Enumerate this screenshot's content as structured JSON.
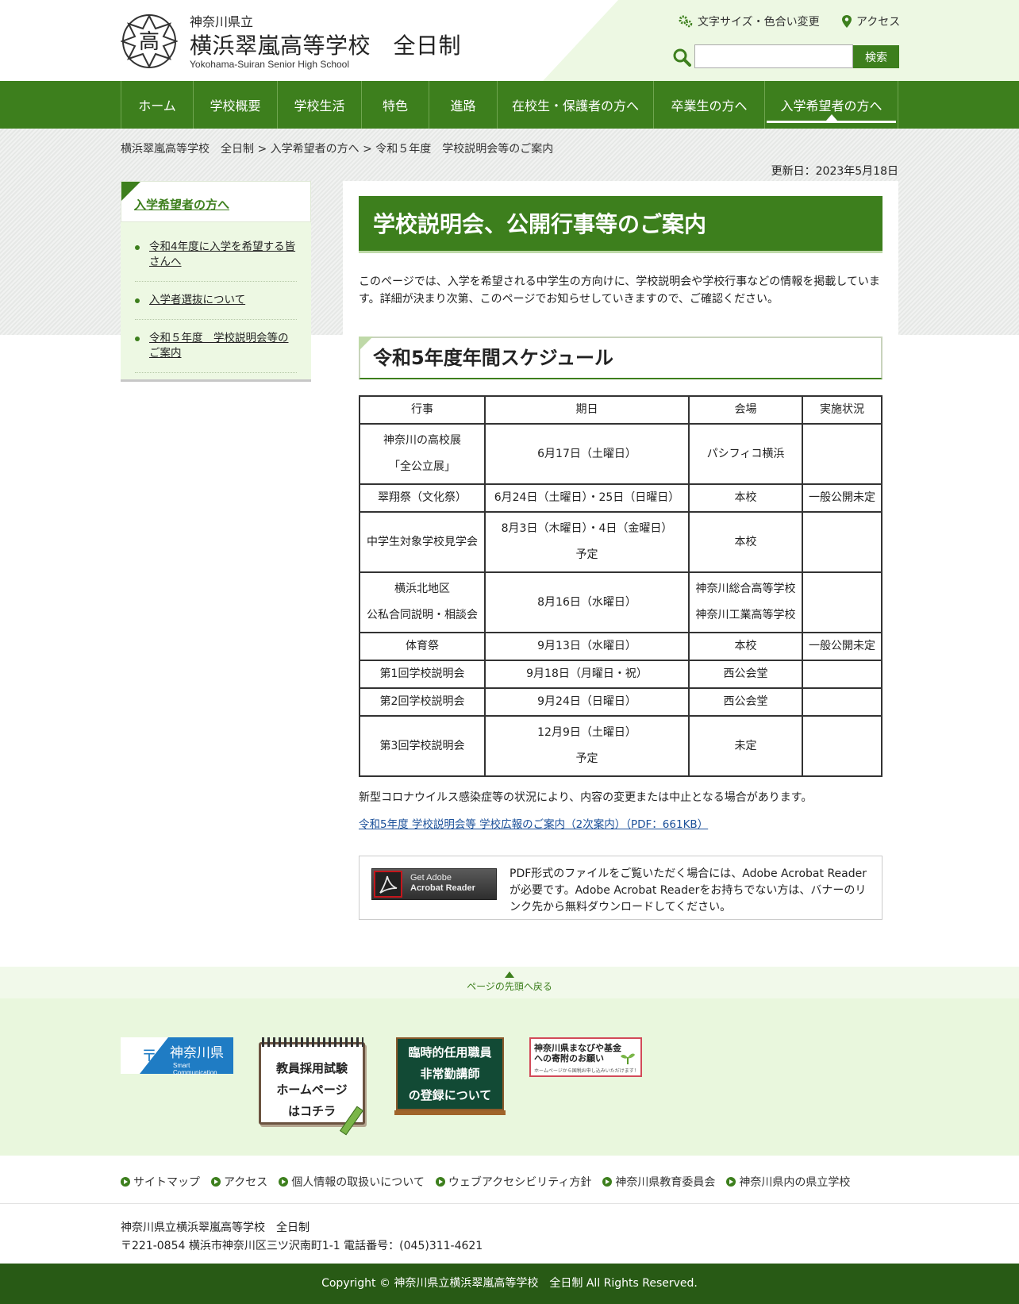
{
  "header": {
    "pref": "神奈川県立",
    "school_name": "横浜翠嵐高等学校　全日制",
    "school_en": "Yokohama-Suiran Senior High School",
    "font_color_link": "文字サイズ・色合い変更",
    "access_link": "アクセス",
    "search_placeholder": "",
    "search_button": "検索"
  },
  "nav": [
    {
      "label": "ホーム"
    },
    {
      "label": "学校概要"
    },
    {
      "label": "学校生活"
    },
    {
      "label": "特色"
    },
    {
      "label": "進路"
    },
    {
      "label": "在校生・保護者の方へ"
    },
    {
      "label": "卒業生の方へ"
    },
    {
      "label": "入学希望者の方へ",
      "active": true
    }
  ],
  "breadcrumb": "横浜翠嵐高等学校　全日制 > 入学希望者の方へ > 令和５年度　学校説明会等のご案内",
  "updated": "更新日：2023年5月18日",
  "sidebar": {
    "heading": "入学希望者の方へ",
    "items": [
      {
        "label": "令和4年度に入学を希望する皆さんへ"
      },
      {
        "label": "入学者選抜について"
      },
      {
        "label": "令和５年度　学校説明会等のご案内"
      }
    ]
  },
  "main": {
    "title": "学校説明会、公開行事等のご案内",
    "intro": "このページでは、入学を希望される中学生の方向けに、学校説明会や学校行事などの情報を掲載しています。詳細が決まり次第、このページでお知らせしていきますので、ご確認ください。",
    "section_heading": "令和5年度年間スケジュール",
    "table": {
      "headers": [
        "行事",
        "期日",
        "会場",
        "実施状況"
      ],
      "rows": [
        {
          "event": [
            "神奈川の高校展",
            "「全公立展」"
          ],
          "date": [
            "6月17日（土曜日）"
          ],
          "venue": [
            "パシフィコ横浜"
          ],
          "status": ""
        },
        {
          "event": [
            "翠翔祭（文化祭）"
          ],
          "date": [
            "6月24日（土曜日）・25日（日曜日）"
          ],
          "venue": [
            "本校"
          ],
          "status": "一般公開未定"
        },
        {
          "event": [
            "中学生対象学校見学会"
          ],
          "date": [
            "8月3日（木曜日）・4日（金曜日）",
            "予定"
          ],
          "venue": [
            "本校"
          ],
          "status": ""
        },
        {
          "event": [
            "横浜北地区",
            "公私合同説明・相談会"
          ],
          "date": [
            "8月16日（水曜日）"
          ],
          "venue": [
            "神奈川総合高等学校",
            "神奈川工業高等学校"
          ],
          "status": ""
        },
        {
          "event": [
            "体育祭"
          ],
          "date": [
            "9月13日（水曜日）"
          ],
          "venue": [
            "本校"
          ],
          "status": "一般公開未定"
        },
        {
          "event": [
            "第1回学校説明会"
          ],
          "date": [
            "9月18日（月曜日・祝）"
          ],
          "venue": [
            "西公会堂"
          ],
          "status": ""
        },
        {
          "event": [
            "第2回学校説明会"
          ],
          "date": [
            "9月24日（日曜日）"
          ],
          "venue": [
            "西公会堂"
          ],
          "status": ""
        },
        {
          "event": [
            "第3回学校説明会"
          ],
          "date": [
            "12月9日（土曜日）",
            "予定"
          ],
          "venue": [
            "未定"
          ],
          "status": ""
        }
      ]
    },
    "note": "新型コロナウイルス感染症等の状況により、内容の変更または中止となる場合があります。",
    "pdf_link": "令和5年度 学校説明会等 学校広報のご案内（2次案内）（PDF：661KB）",
    "acrobat": {
      "banner_line1": "Get Adobe",
      "banner_line2": "Acrobat Reader",
      "desc": "PDF形式のファイルをご覧いただく場合には、Adobe Acrobat Readerが必要です。Adobe Acrobat Readerをお持ちでない方は、バナーのリンク先から無料ダウンロードしてください。"
    }
  },
  "footer": {
    "pagetop": "ページの先頭へ戻る",
    "banners": {
      "kanagawa_title": "神奈川県",
      "kanagawa_sub": "Smart Communication",
      "teacher": [
        "教員採用試験",
        "ホームページ",
        "はコチラ"
      ],
      "temp": [
        "臨時的任用職員",
        "非常勤講師",
        "の登録について"
      ],
      "fund_title": "神奈川県まなびや基金への寄附のお願い",
      "fund_sub": "ホームページから国税お申し込みいただけます！"
    },
    "links": [
      {
        "label": "サイトマップ"
      },
      {
        "label": "アクセス"
      },
      {
        "label": "個人情報の取扱いについて"
      },
      {
        "label": "ウェブアクセシビリティ方針"
      },
      {
        "label": "神奈川県教育委員会"
      },
      {
        "label": "神奈川県内の県立学校"
      }
    ],
    "address_name": "神奈川県立横浜翠嵐高等学校　全日制",
    "address_line": "〒221-0854 横浜市神奈川区三ツ沢南町1-1 電話番号：(045)311-4621",
    "copyright": "Copyright © 神奈川県立横浜翠嵐高等学校　全日制 All Rights Reserved."
  },
  "colors": {
    "brand_green": "#3d7f1d",
    "light_green": "#edf8e3",
    "footer_dark": "#285a15",
    "link_blue": "#1a4f99"
  }
}
